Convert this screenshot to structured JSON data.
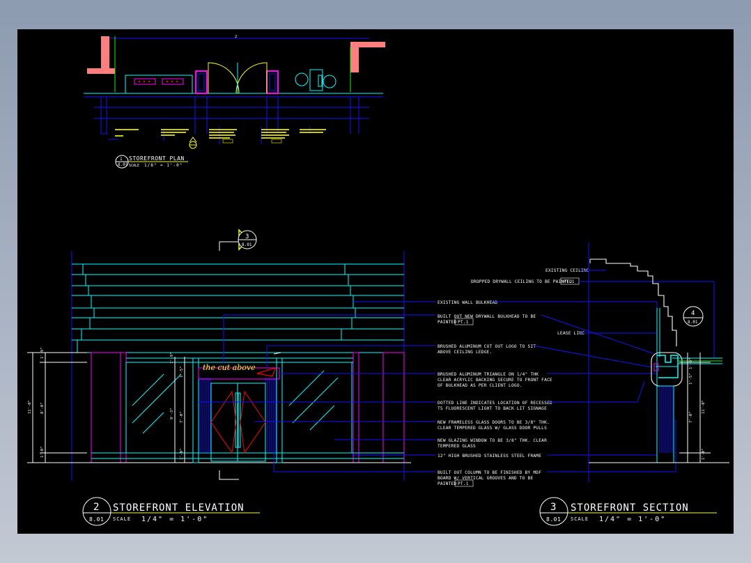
{
  "plan": {
    "overall_dim": "2",
    "title": "STOREFRONT PLAN",
    "number": "1",
    "sheet": "8.01",
    "scale_label": "SCALE",
    "scale": "1/8\" = 1'-0\""
  },
  "elevation": {
    "number": "2",
    "sheet": "8.01",
    "title": "STOREFRONT ELEVATION",
    "scale_label": "SCALE",
    "scale": "1/4\" = 1'-0\"",
    "logo_text": "the cut above",
    "dims": [
      "1'-9\"",
      "1'-9\"",
      "8'-0\"",
      "11'-0\"",
      "1'-5\"",
      "9'-3\"",
      "7'-0\"",
      "1'-0\"",
      "1'-0\""
    ]
  },
  "section": {
    "number": "3",
    "sheet": "8.01",
    "title": "STOREFRONT SECTION",
    "scale_label": "SCALE",
    "scale": "1/4\" = 1'-0\"",
    "dims": [
      "1'-9\"",
      "1'-5\"",
      "7'-0\"",
      "11'-0\"",
      "1'-0\""
    ]
  },
  "callouts": {
    "section_marker": {
      "number": "3",
      "sheet": "8.01"
    },
    "detail_marker": {
      "number": "4",
      "sheet": "8.01"
    }
  },
  "notes": {
    "existing_ceiling": "EXISTING CEILING",
    "dropped_ceiling": "DROPPED DRYWALL CEILING TO BE PAINTED",
    "pt1": "PT.1",
    "bulkhead": "EXISTING WALL BULKHEAD",
    "new_bulkhead_1": "BUILT OUT NEW DRYWALL BULKHEAD TO BE",
    "new_bulkhead_2": "PAINTED",
    "lease_line": "LEASE LINE",
    "logo_1": "BRUSHED ALUMINUM CUT OUT LOGO TO SIT",
    "logo_2": "ABOVE CEILING LEDGE.",
    "triangle_1": "BRUSHED ALUMINUM TRIANGLE ON 1/4\" THK",
    "triangle_2": "CLEAR ACRYLIC BACKING SECURE TO FRONT FACE",
    "triangle_3": "OF BULKHEAD AS PER CLIENT LOGO.",
    "dotted_1": "DOTTED LINE INDICATES LOCATION OF RECESSED",
    "dotted_2": "T5 FLUORESCENT LIGHT TO BACK LIT SIGNAGE",
    "doors_1": "NEW FRAMELESS GLASS DOORS TO BE 3/8\" THK.",
    "doors_2": "CLEAR TEMPERED GLASS W/ GLASS DOOR PULLS",
    "glazing_1": "NEW GLAZING WINDOW TO BE 3/8\" THK. CLEAR",
    "glazing_2": "TEMPERED GLASS",
    "frame": "12\" HIGH BRUSHED STAINLESS STEEL FRAME",
    "column_1": "BUILT OUT COLUMN TO BE FINISHED BY MDF",
    "column_2": "BOARD W/ VERTICAL GROOVES AND TO BE",
    "column_3": "PAINTED"
  },
  "colors": {
    "background": "#000000",
    "cyan": "#00ffff",
    "blue": "#1414ff",
    "magenta": "#ff00ff",
    "yellow": "#ffff00",
    "red": "#ff0000",
    "green": "#00ff00",
    "white": "#ffffff",
    "wall_fill": "#ff7f7f"
  }
}
